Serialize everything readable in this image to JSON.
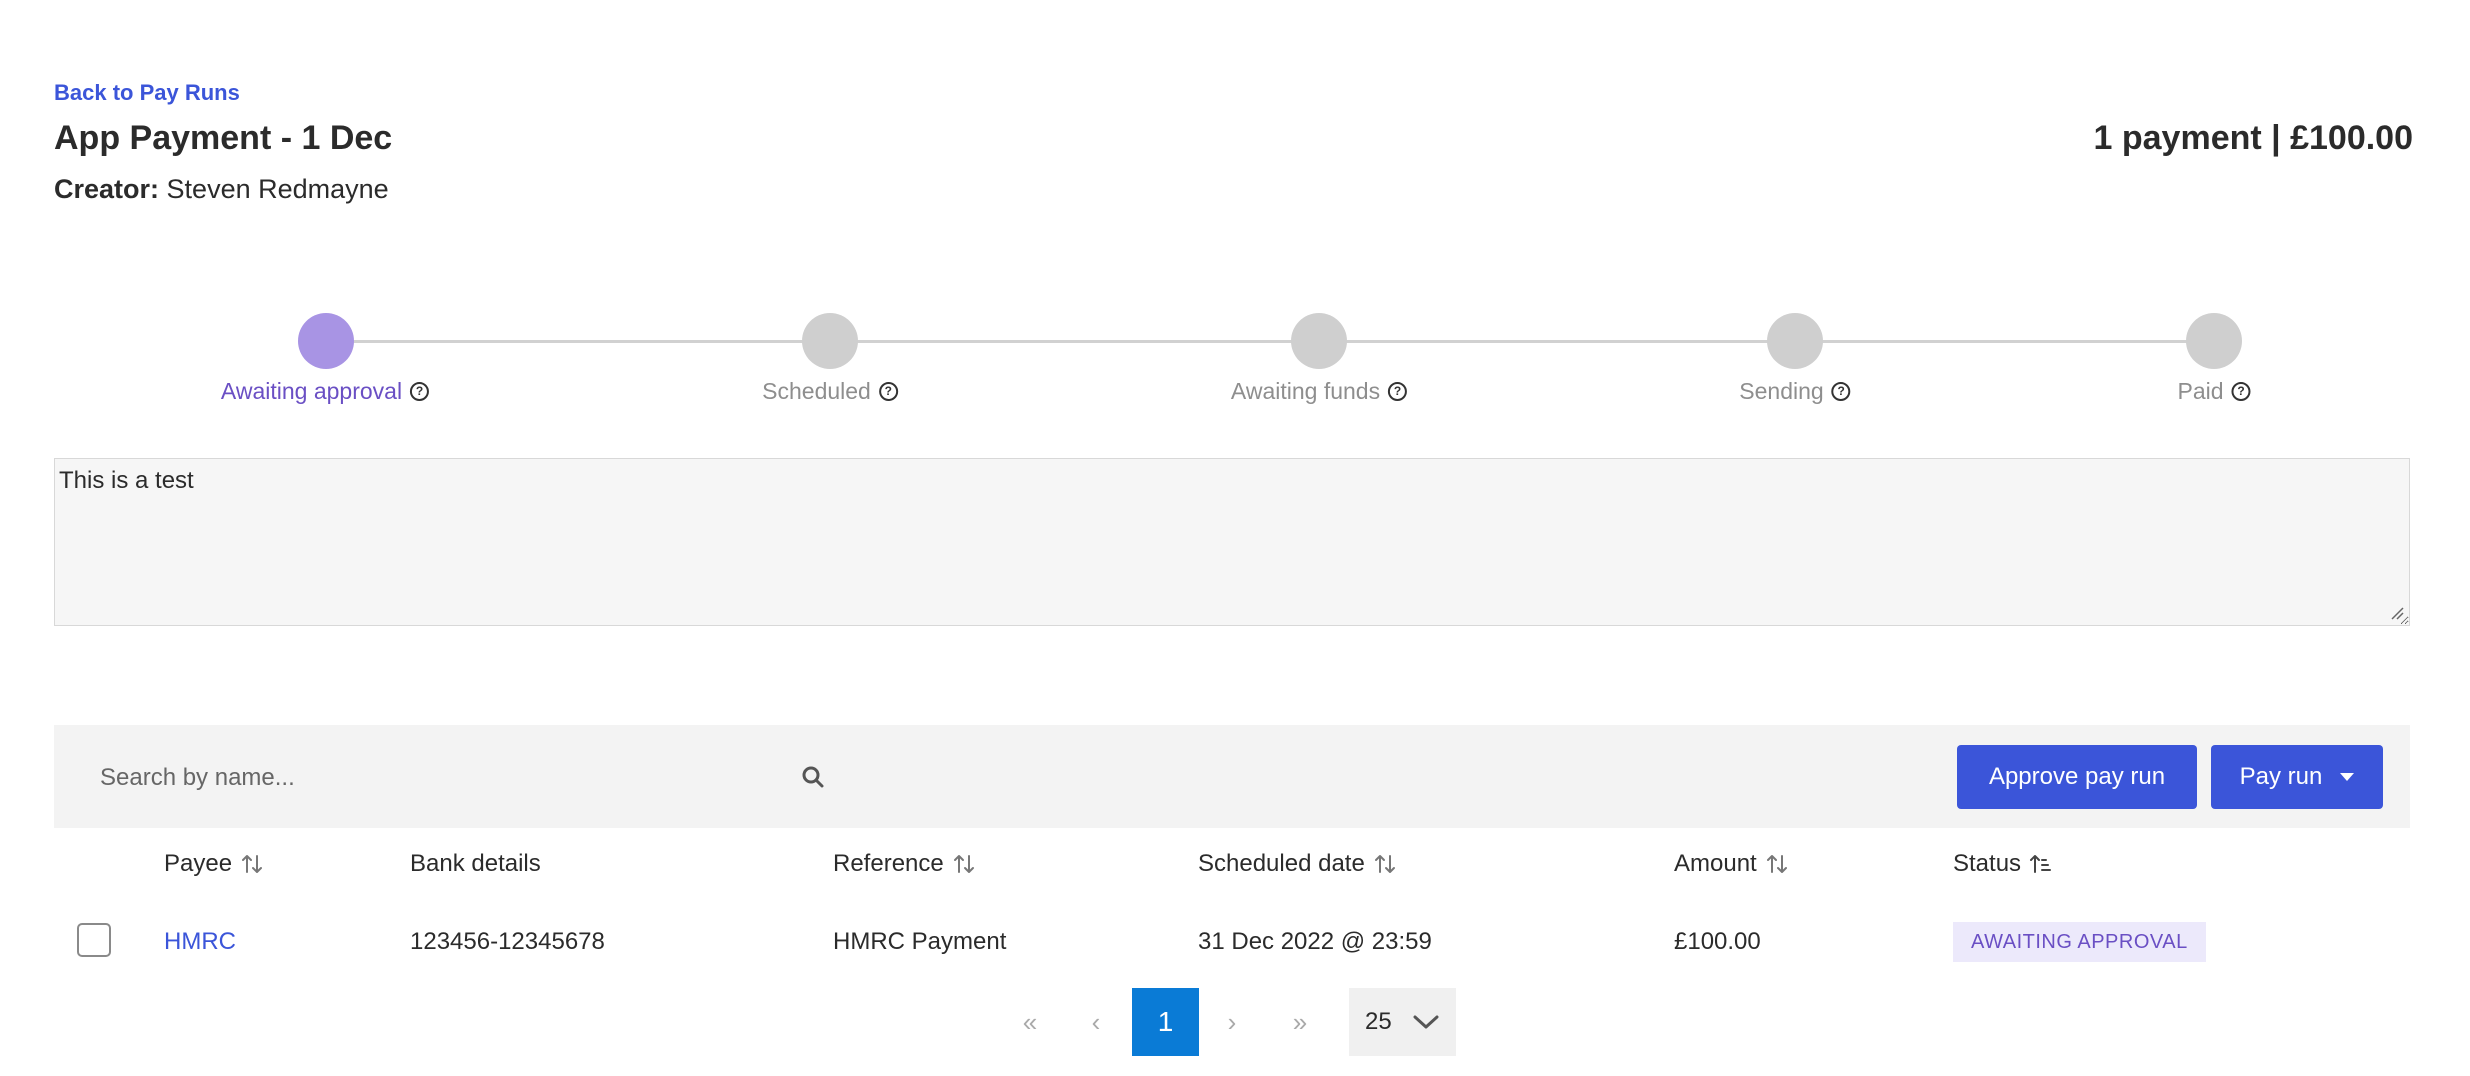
{
  "header": {
    "back_link": "Back to Pay Runs",
    "title": "App Payment - 1 Dec",
    "summary": "1 payment | £100.00",
    "creator_label": "Creator:",
    "creator_name": "Steven Redmayne"
  },
  "stepper": {
    "steps": [
      {
        "label": "Awaiting approval",
        "state": "active"
      },
      {
        "label": "Scheduled",
        "state": "inactive"
      },
      {
        "label": "Awaiting funds",
        "state": "inactive"
      },
      {
        "label": "Sending",
        "state": "inactive"
      },
      {
        "label": "Paid",
        "state": "inactive"
      }
    ],
    "help_glyph": "?"
  },
  "notes": {
    "value": "This is a test"
  },
  "toolbar": {
    "search_placeholder": "Search by name...",
    "approve_label": "Approve pay run",
    "payrun_label": "Pay run"
  },
  "table": {
    "columns": [
      "Payee",
      "Bank details",
      "Reference",
      "Scheduled date",
      "Amount",
      "Status"
    ],
    "rows": [
      {
        "payee": "HMRC",
        "bank_details": "123456-12345678",
        "reference": "HMRC Payment",
        "scheduled_date": "31 Dec 2022 @ 23:59",
        "amount": "£100.00",
        "status": "AWAITING APPROVAL"
      }
    ]
  },
  "pagination": {
    "first": "«",
    "prev": "‹",
    "current_page": "1",
    "next": "›",
    "last": "»",
    "page_size": "25"
  },
  "colors": {
    "accent": "#3b55d9",
    "active_step": "#a894e4",
    "status_text": "#6a4fc4",
    "page_active": "#0a7bd6"
  }
}
